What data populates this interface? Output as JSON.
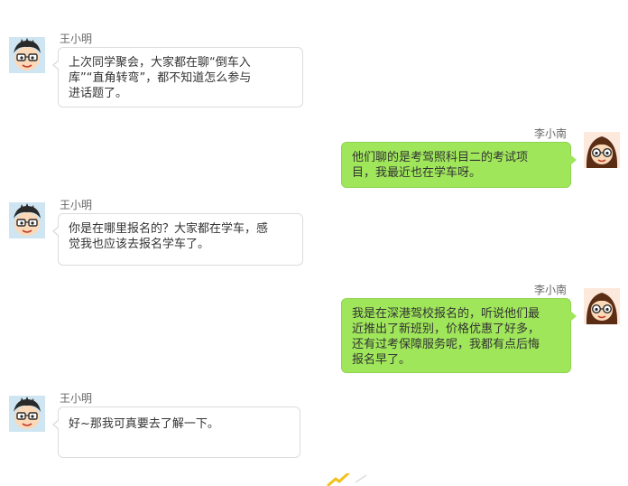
{
  "chat": {
    "messages": [
      {
        "sender": "王小明",
        "side": "left",
        "lines": [
          "上次同学聚会，大家都在聊“倒车入",
          "库”“直角转弯”，都不知道怎么参与",
          "进话题了。"
        ]
      },
      {
        "sender": "李小南",
        "side": "right",
        "lines": [
          "他们聊的是考驾照科目二的考试项",
          "目，我最近也在学车呀。"
        ]
      },
      {
        "sender": "王小明",
        "side": "left",
        "lines": [
          "你是在哪里报名的？大家都在学车，感",
          "觉我也应该去报名学车了。"
        ]
      },
      {
        "sender": "李小南",
        "side": "right",
        "lines": [
          "我是在深港驾校报名的，听说他们最",
          "近推出了新班别，价格优惠了好多，",
          "还有过考保障服务呢，我都有点后悔",
          "报名早了。"
        ]
      },
      {
        "sender": "王小明",
        "side": "left",
        "lines": [
          "好~那我可真要去了解一下。"
        ]
      }
    ]
  },
  "colors": {
    "right_bubble": "#9fe65b",
    "left_bubble": "#ffffff"
  }
}
